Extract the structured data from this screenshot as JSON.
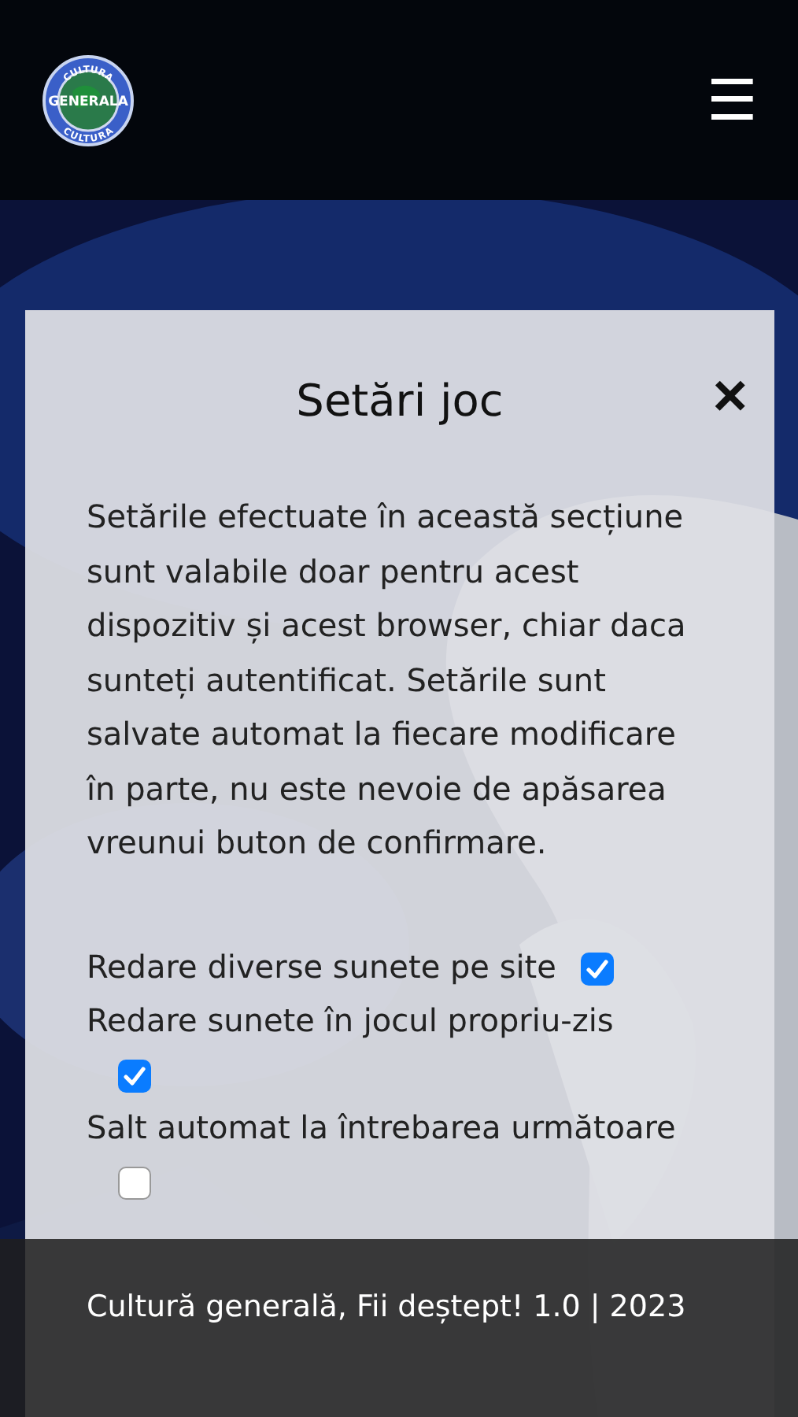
{
  "header": {
    "logo": {
      "top_text": "CULTURA",
      "word": "GENERALA",
      "bottom_text": "CULTURA"
    },
    "menu_icon": "☰"
  },
  "modal": {
    "title": "Setări joc",
    "close": "×",
    "intro": "Setările efectuate în această secțiune sunt valabile doar pentru acest dispozitiv și acest browser, chiar daca sunteți autentificat. Setările sunt salvate automat la fiecare modificare în parte, nu este nevoie de apăsarea vreunui buton de confirmare.",
    "settings": [
      {
        "label": "Redare diverse sunete pe site",
        "checked": true
      },
      {
        "label": "Redare sunete în jocul propriu-zis",
        "checked": true
      },
      {
        "label": "Salt automat la întrebarea următoare",
        "checked": false
      }
    ]
  },
  "footer": {
    "text": "Cultură generală, Fii deștept! 1.0 | 2023"
  }
}
